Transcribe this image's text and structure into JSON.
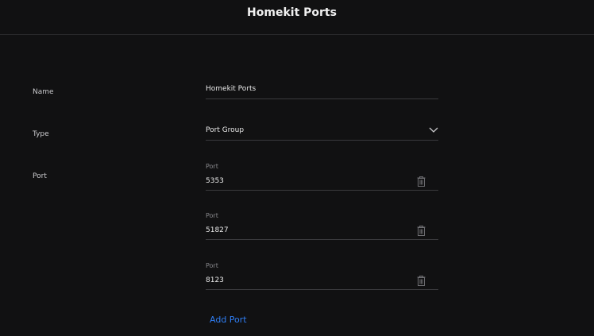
{
  "header": {
    "title": "Homekit Ports"
  },
  "form": {
    "name_label": "Name",
    "name_value": "Homekit Ports",
    "type_label": "Type",
    "type_value": "Port Group",
    "port_label": "Port",
    "ports": [
      {
        "caption": "Port",
        "value": "5353"
      },
      {
        "caption": "Port",
        "value": "51827"
      },
      {
        "caption": "Port",
        "value": "8123"
      }
    ],
    "add_port_label": "Add Port"
  },
  "colors": {
    "accent": "#2f7ef5",
    "background": "#111112"
  },
  "icons": {
    "type_dropdown": "chevron-down-icon",
    "delete": "trash-icon"
  }
}
